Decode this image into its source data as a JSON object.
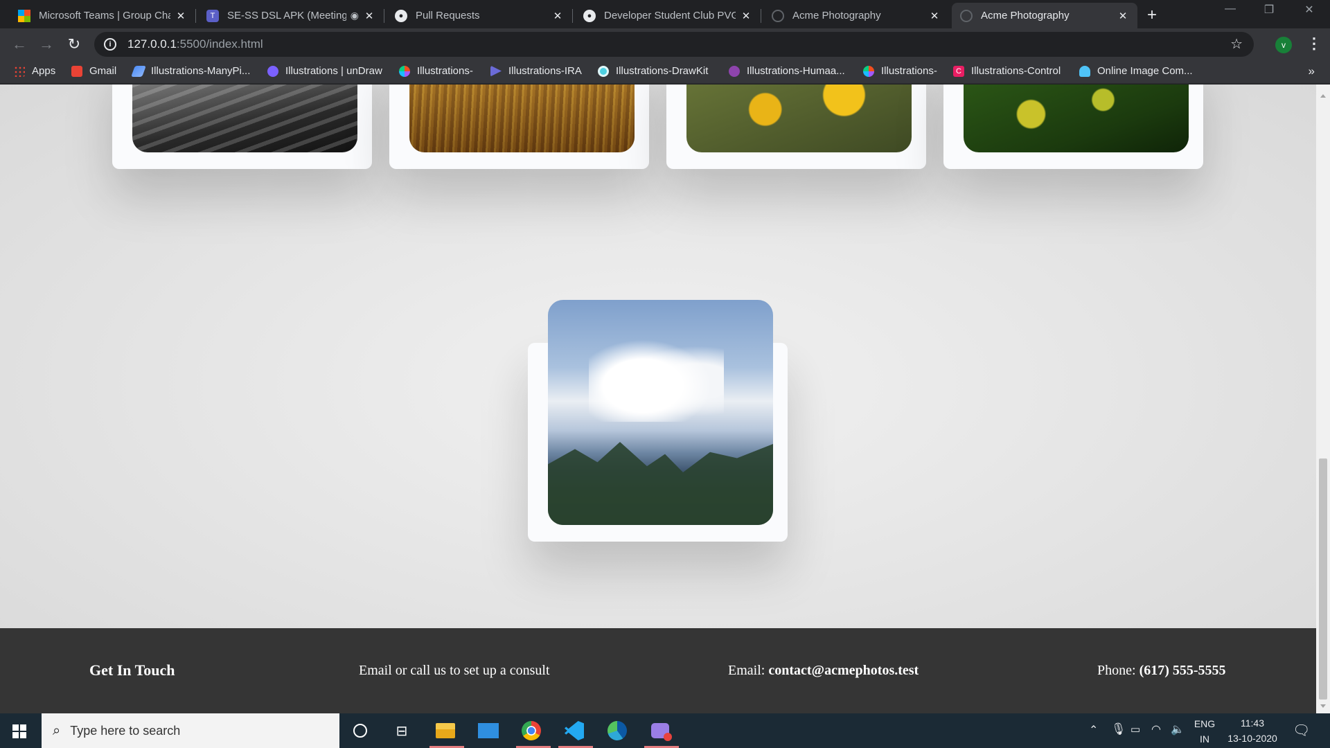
{
  "browser": {
    "tabs": [
      {
        "title": "Microsoft Teams | Group Cha",
        "icon": "microsoft-icon",
        "active": false
      },
      {
        "title": "SE-SS DSL APK (Meeting",
        "icon": "teams-icon",
        "active": false
      },
      {
        "title": "Pull Requests",
        "icon": "github-icon",
        "active": false
      },
      {
        "title": "Developer Student Club PVG",
        "icon": "github-icon",
        "active": false
      },
      {
        "title": "Acme Photography",
        "icon": "globe-icon",
        "active": false
      },
      {
        "title": "Acme Photography",
        "icon": "globe-icon",
        "active": true
      }
    ],
    "new_tab": "+",
    "address": {
      "host": "127.0.0.1",
      "path": ":5500/index.html"
    },
    "profile_initial": "v"
  },
  "bookmarks": [
    {
      "label": "Apps",
      "icon": "apps-icon"
    },
    {
      "label": "Gmail",
      "icon": "gmail-icon"
    },
    {
      "label": "Illustrations-ManyPi...",
      "icon": "manypixels-icon"
    },
    {
      "label": "Illustrations | unDraw",
      "icon": "undraw-icon"
    },
    {
      "label": "Illustrations-",
      "icon": "figma-icon"
    },
    {
      "label": "Illustrations-IRA",
      "icon": "ira-icon"
    },
    {
      "label": "Illustrations-DrawKit",
      "icon": "drawkit-icon"
    },
    {
      "label": "Illustrations-Humaa...",
      "icon": "humaaans-icon"
    },
    {
      "label": "Illustrations-",
      "icon": "figma-icon"
    },
    {
      "label": "Illustrations-Control",
      "icon": "control-icon"
    },
    {
      "label": "Online Image Com...",
      "icon": "image-compressor-icon"
    }
  ],
  "bookmarks_more": "»",
  "footer": {
    "title": "Get In Touch",
    "tagline": "Email or call us to set up a consult",
    "email_label": "Email:",
    "email_value": "contact@acmephotos.test",
    "phone_label": "Phone:",
    "phone_value": "(617) 555-5555"
  },
  "taskbar": {
    "search_placeholder": "Type here to search",
    "lang_top": "ENG",
    "lang_bottom": "IN",
    "time": "11:43",
    "date": "13-10-2020"
  }
}
